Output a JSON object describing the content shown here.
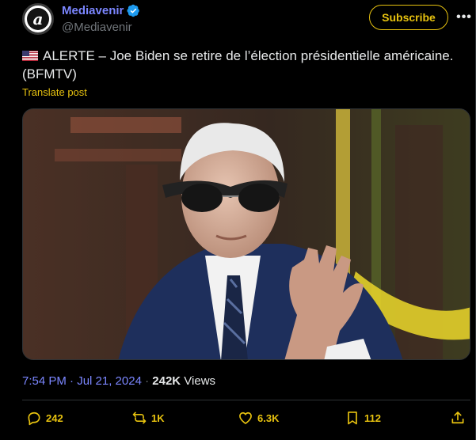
{
  "account": {
    "name": "Mediavenir",
    "handle": "@Mediavenir",
    "avatar_letter": "a",
    "verified_icon": "verified-badge-icon"
  },
  "header": {
    "subscribe_label": "Subscribe",
    "more_label": "•••"
  },
  "post": {
    "flag_icon": "us-flag-icon",
    "text": "ALERTE – Joe Biden se retire de l’élection présidentielle américaine. (BFMTV)",
    "translate_label": "Translate post"
  },
  "meta": {
    "time": "7:54 PM · Jul 21, 2024",
    "separator": " · ",
    "views_count": "242K",
    "views_label": " Views"
  },
  "actions": {
    "replies": "242",
    "reposts": "1K",
    "likes": "6.3K",
    "bookmarks": "112"
  },
  "colors": {
    "accent": "#e7c20f",
    "name": "#7b86ff",
    "background": "#000000",
    "muted": "#71767b"
  }
}
